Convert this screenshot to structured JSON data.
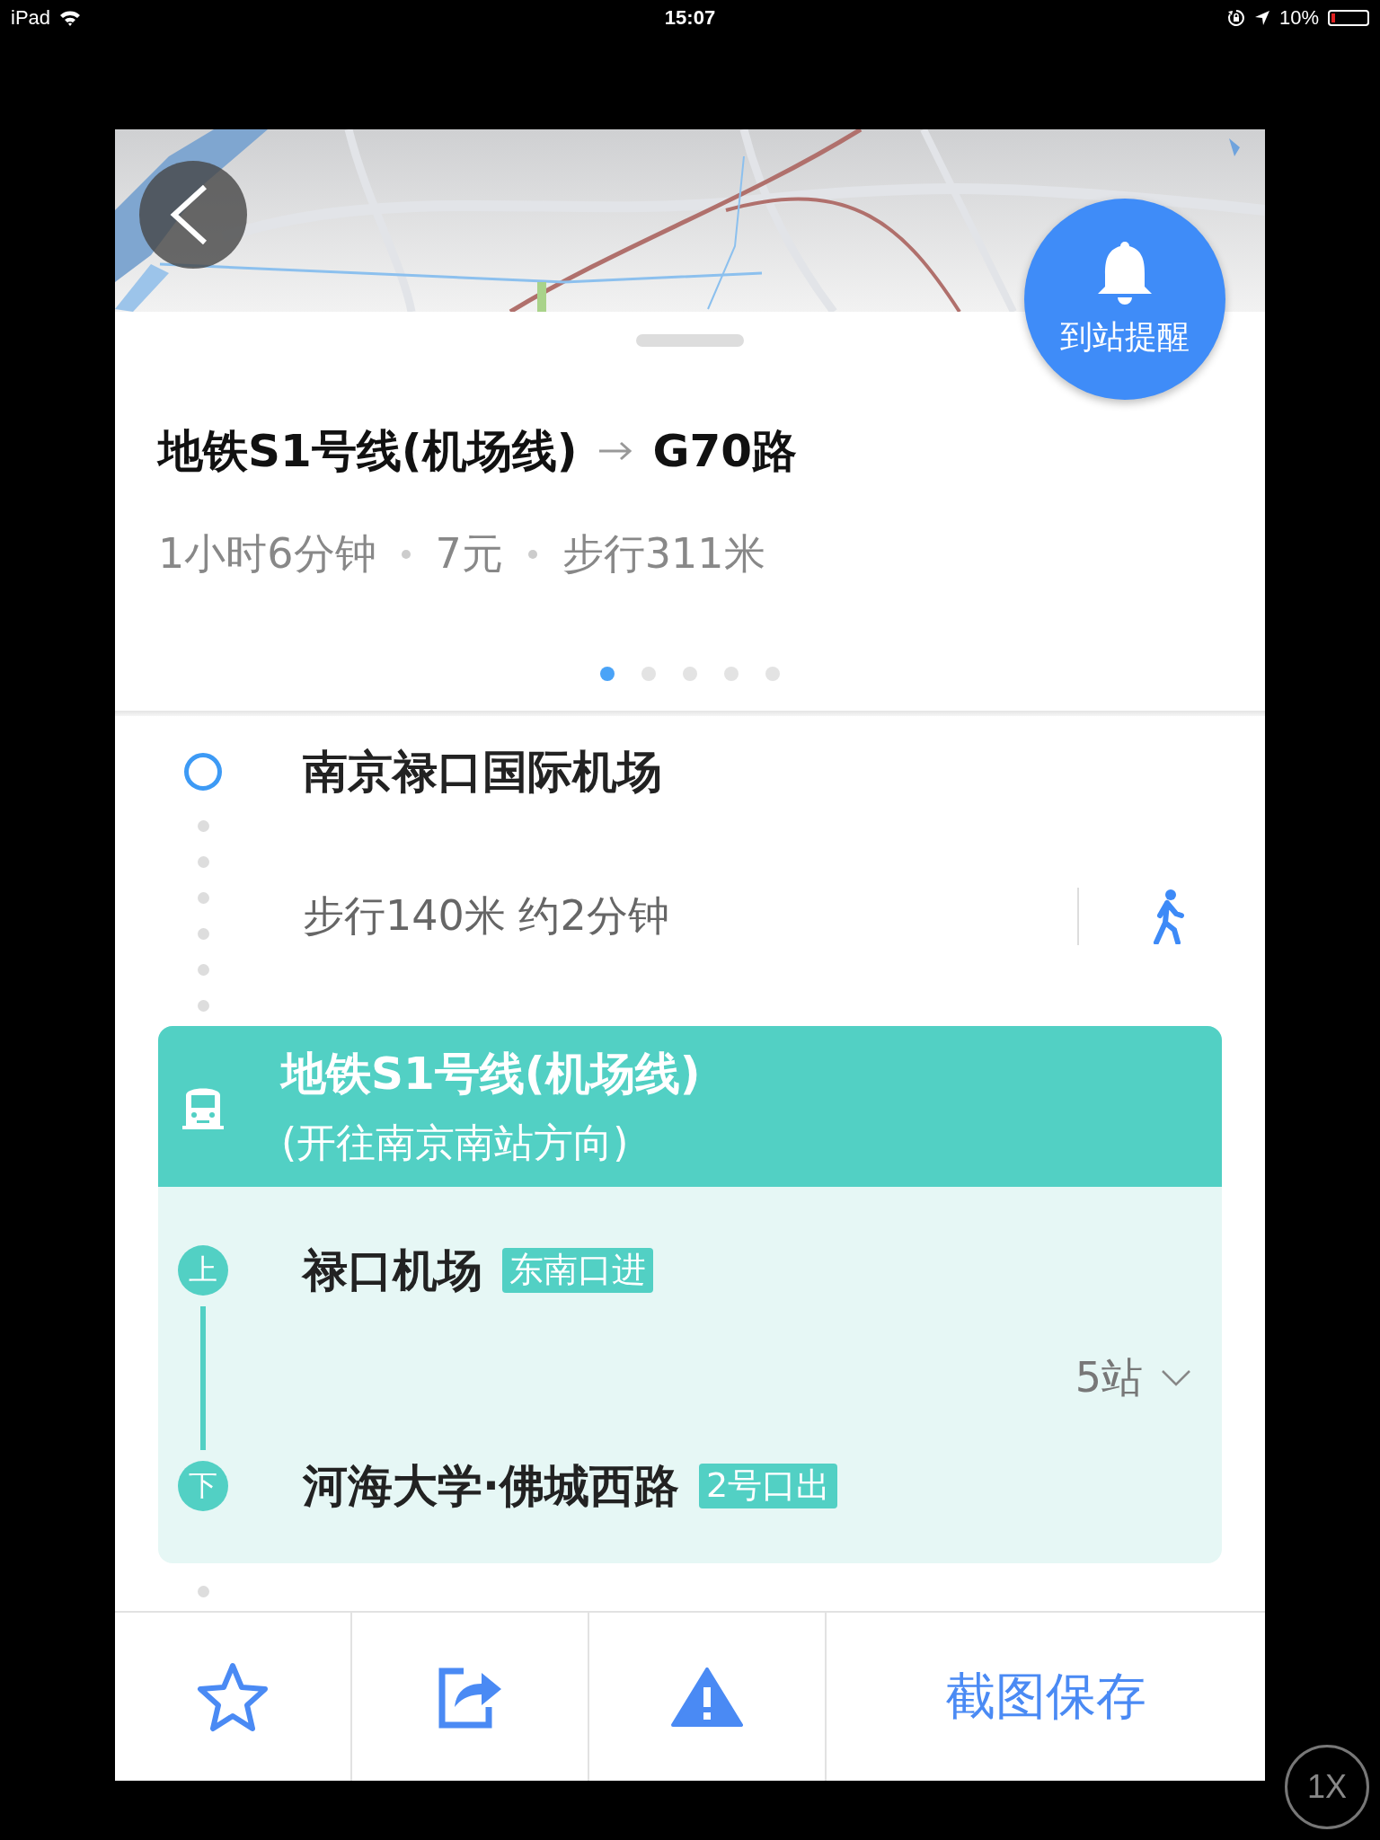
{
  "status_bar": {
    "device": "iPad",
    "time": "15:07",
    "battery_text": "10%",
    "battery": {
      "level": 0.1
    }
  },
  "reminder_button": {
    "label": "到站提醒"
  },
  "route": {
    "title_from": "地铁S1号线(机场线)",
    "title_to": "G70路",
    "summary": [
      "1小时6分钟",
      "7元",
      "步行311米"
    ],
    "pages": [
      {
        "selected": true
      },
      {
        "selected": false
      },
      {
        "selected": false
      },
      {
        "selected": false
      },
      {
        "selected": false
      }
    ]
  },
  "steps": [
    {
      "kind": "origin",
      "name": "南京禄口国际机场"
    },
    {
      "kind": "walk",
      "text": "步行140米 约2分钟"
    },
    {
      "kind": "transit",
      "line": "地铁S1号线(机场线)",
      "direction": "(开往南京南站方向)",
      "board": {
        "marker": "上",
        "station": "禄口机场",
        "exit": "东南口进"
      },
      "stops": "5站",
      "alight": {
        "marker": "下",
        "station": "河海大学·佛城西路",
        "exit": "2号口出"
      }
    }
  ],
  "toolbar": {
    "save_label": "截图保存"
  },
  "zoom_button": "1X"
}
